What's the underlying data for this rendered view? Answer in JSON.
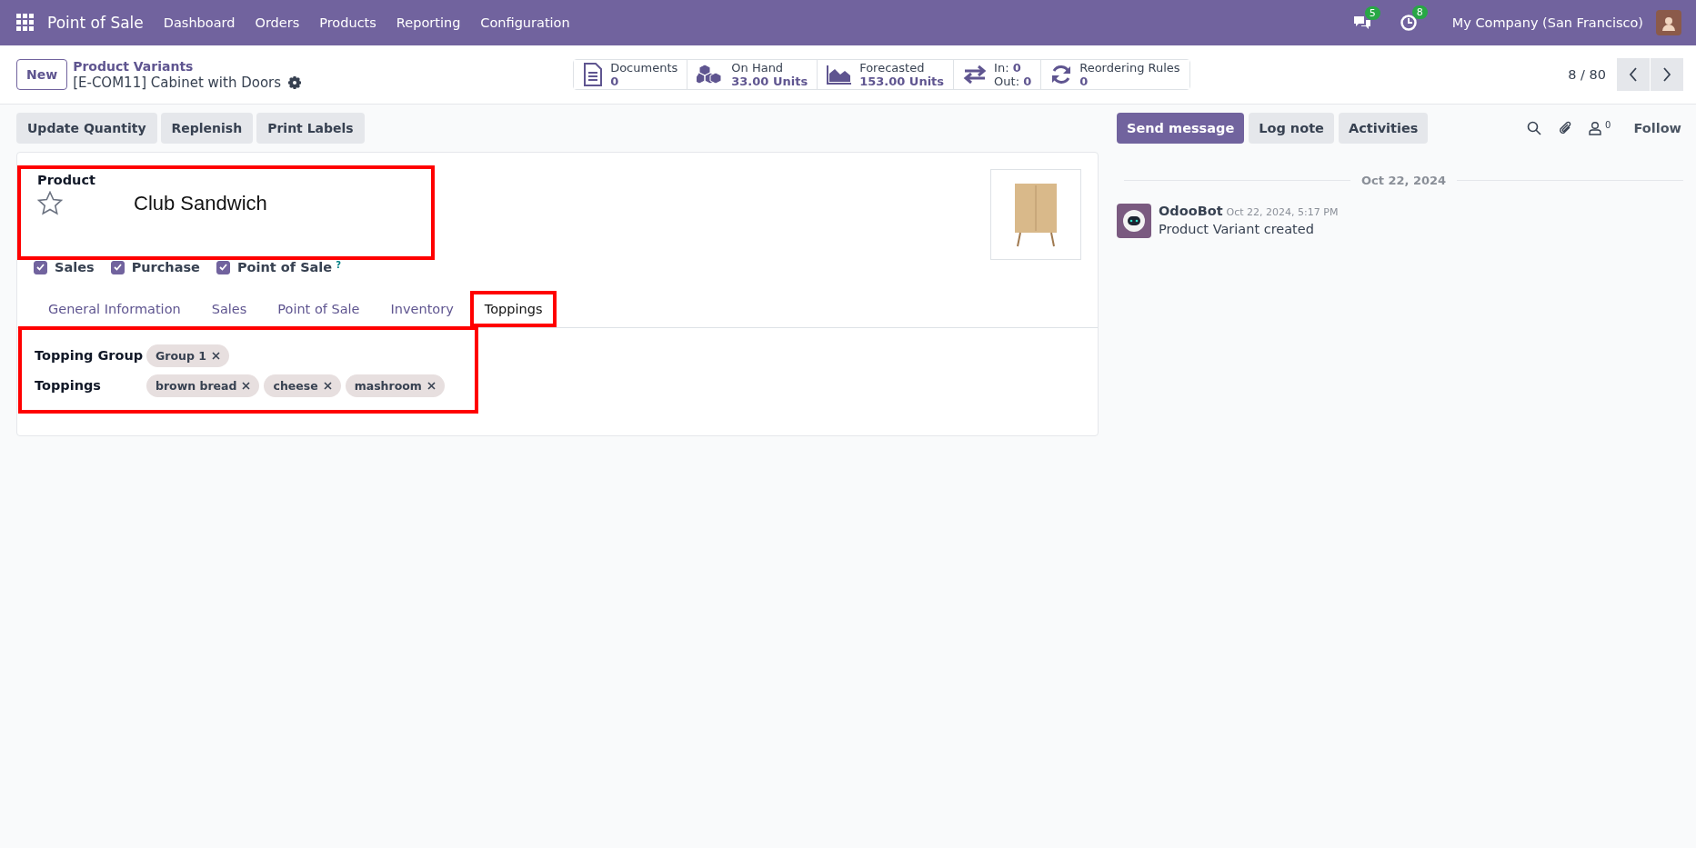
{
  "navbar": {
    "app_name": "Point of Sale",
    "menu": [
      "Dashboard",
      "Orders",
      "Products",
      "Reporting",
      "Configuration"
    ],
    "messages_count": "5",
    "activities_count": "8",
    "company": "My Company (San Francisco)"
  },
  "control_panel": {
    "new_button": "New",
    "breadcrumb": "Product Variants",
    "record_title": "[E-COM11] Cabinet with Doors",
    "stat_buttons": [
      {
        "kind": "single",
        "label": "Documents",
        "value": "0"
      },
      {
        "kind": "single",
        "label": "On Hand",
        "value": "33.00 Units"
      },
      {
        "kind": "single",
        "label": "Forecasted",
        "value": "153.00 Units"
      },
      {
        "kind": "inout",
        "in_label": "In:",
        "in_value": "0",
        "out_label": "Out:",
        "out_value": "0"
      },
      {
        "kind": "single",
        "label": "Reordering Rules",
        "value": "0"
      }
    ],
    "pager": "8 / 80"
  },
  "action_buttons": [
    "Update Quantity",
    "Replenish",
    "Print Labels"
  ],
  "form": {
    "name_label": "Product",
    "favorite": false,
    "product_name": "Club Sandwich",
    "name_highlighted": true,
    "options": [
      {
        "label": "Sales",
        "checked": true
      },
      {
        "label": "Purchase",
        "checked": true
      },
      {
        "label": "Point of Sale",
        "checked": true,
        "help": "?"
      }
    ],
    "tabs": [
      {
        "label": "General Information",
        "selected": false,
        "highlighted": false
      },
      {
        "label": "Sales",
        "selected": false,
        "highlighted": false
      },
      {
        "label": "Point of Sale",
        "selected": false,
        "highlighted": false
      },
      {
        "label": "Inventory",
        "selected": false,
        "highlighted": false
      },
      {
        "label": "Toppings",
        "selected": true,
        "highlighted": true
      }
    ],
    "fields_highlighted": true,
    "fields": [
      {
        "label": "Topping Group",
        "tags": [
          "Group 1"
        ]
      },
      {
        "label": "Toppings",
        "tags": [
          "brown bread",
          "cheese",
          "mashroom"
        ]
      }
    ]
  },
  "chatter": {
    "buttons": [
      {
        "label": "Send message",
        "primary": true
      },
      {
        "label": "Log note",
        "primary": false
      },
      {
        "label": "Activities",
        "primary": false
      }
    ],
    "followers_count": "0",
    "follow": "Follow",
    "date_separator": "Oct 22, 2024",
    "messages": [
      {
        "author": "OdooBot",
        "time": "Oct 22, 2024, 5:17 PM",
        "body": "Product Variant created"
      }
    ]
  }
}
